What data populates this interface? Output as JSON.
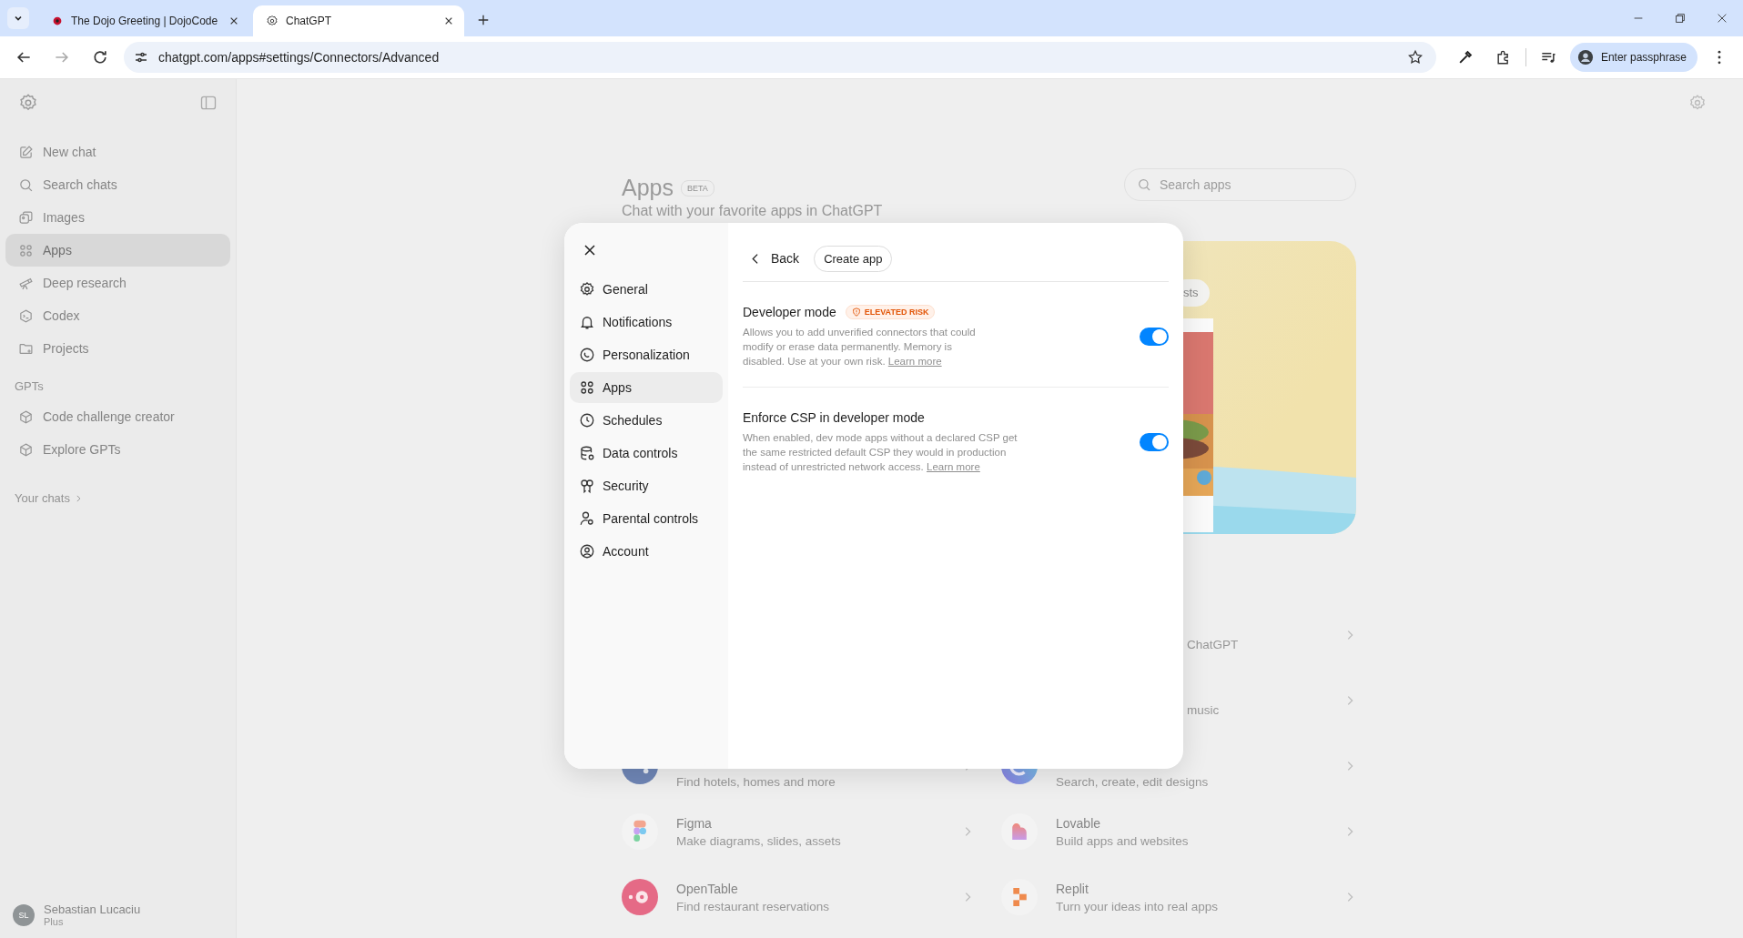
{
  "browser": {
    "tabs": [
      {
        "title": "The Dojo Greeting | DojoCode",
        "selected": false
      },
      {
        "title": "ChatGPT",
        "selected": true
      }
    ],
    "url": "chatgpt.com/apps#settings/Connectors/Advanced",
    "profile_label": "Enter passphrase"
  },
  "sidebar": {
    "items": [
      {
        "label": "New chat",
        "selected": false
      },
      {
        "label": "Search chats",
        "selected": false
      },
      {
        "label": "Images",
        "selected": false
      },
      {
        "label": "Apps",
        "selected": true
      },
      {
        "label": "Deep research",
        "selected": false
      },
      {
        "label": "Codex",
        "selected": false
      },
      {
        "label": "Projects",
        "selected": false
      }
    ],
    "gpts_heading": "GPTs",
    "gpts": [
      "Code challenge creator",
      "Explore GPTs"
    ],
    "your_chats": "Your chats",
    "user": {
      "initials": "SL",
      "name": "Sebastian Lucaciu",
      "plan": "Plus"
    }
  },
  "page": {
    "title": "Apps",
    "badge": "BETA",
    "subtitle": "Chat with your favorite apps in ChatGPT",
    "search_placeholder": "Search apps",
    "hero_chip": "sts",
    "app_rows": [
      {
        "right": {
          "kind": "fragment",
          "text": "ChatGPT"
        }
      },
      {
        "right": {
          "kind": "fragment",
          "text": "music"
        }
      },
      {
        "left": {
          "kind": "description",
          "description": "Find hotels, homes and more"
        },
        "right": {
          "kind": "description",
          "description": "Search, create, edit designs"
        }
      },
      {
        "left": {
          "kind": "app",
          "name": "Figma",
          "description": "Make diagrams, slides, assets"
        },
        "right": {
          "kind": "app",
          "name": "Lovable",
          "description": "Build apps and websites"
        }
      },
      {
        "left": {
          "kind": "app",
          "name": "OpenTable",
          "description": "Find restaurant reservations"
        },
        "right": {
          "kind": "app",
          "name": "Replit",
          "description": "Turn your ideas into real apps"
        }
      }
    ]
  },
  "modal": {
    "nav": [
      {
        "label": "General",
        "selected": false
      },
      {
        "label": "Notifications",
        "selected": false
      },
      {
        "label": "Personalization",
        "selected": false
      },
      {
        "label": "Apps",
        "selected": true
      },
      {
        "label": "Schedules",
        "selected": false
      },
      {
        "label": "Data controls",
        "selected": false
      },
      {
        "label": "Security",
        "selected": false
      },
      {
        "label": "Parental controls",
        "selected": false
      },
      {
        "label": "Account",
        "selected": false
      }
    ],
    "back": "Back",
    "create_app": "Create app",
    "settings": [
      {
        "title": "Developer mode",
        "badge": "ELEVATED RISK",
        "description": "Allows you to add unverified connectors that could modify or erase data permanently. Memory is disabled. Use at your own risk.",
        "link": "Learn more",
        "on": true
      },
      {
        "title": "Enforce CSP in developer mode",
        "description": "When enabled, dev mode apps without a declared CSP get the same restricted default CSP they would in production instead of unrestricted network access.",
        "link": "Learn more",
        "on": true
      }
    ]
  }
}
